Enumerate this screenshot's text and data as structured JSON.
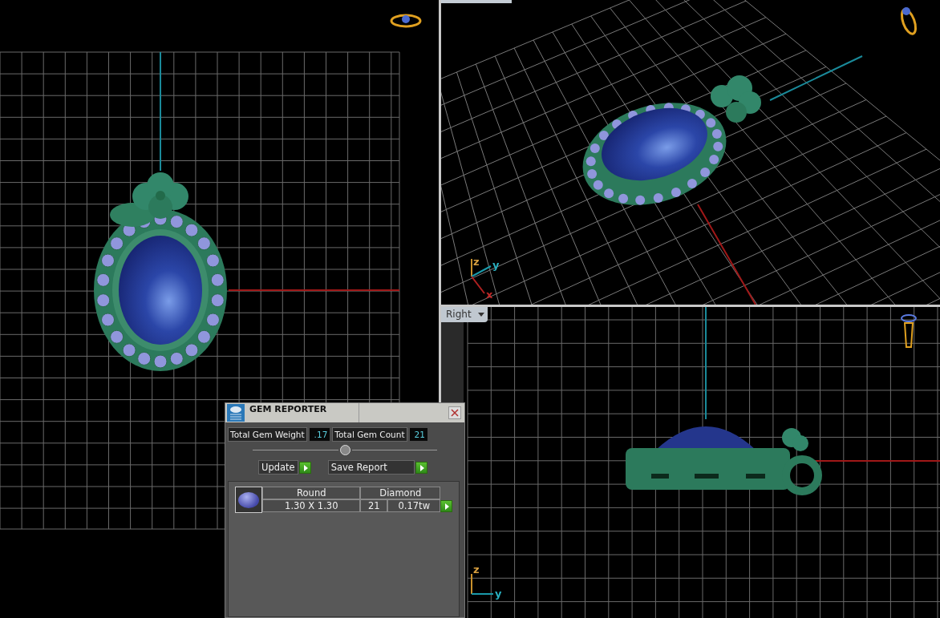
{
  "top_right_view": {
    "axis_labels": [
      "z",
      "y",
      "x"
    ]
  },
  "right_view": {
    "label": "Right",
    "axis_labels": [
      "z",
      "y"
    ]
  },
  "gem_reporter": {
    "title": "GEM REPORTER",
    "total_gem_weight": {
      "label": "Total Gem Weight",
      "value": ".17"
    },
    "total_gem_count": {
      "label": "Total Gem Count",
      "value": "21"
    },
    "buttons": [
      "Update",
      "Save Report"
    ],
    "gems": [
      {
        "shape": "Round",
        "size": "1.30 X 1.30",
        "type": "Diamond",
        "count": "21",
        "weight": "0.17tw"
      }
    ]
  }
}
